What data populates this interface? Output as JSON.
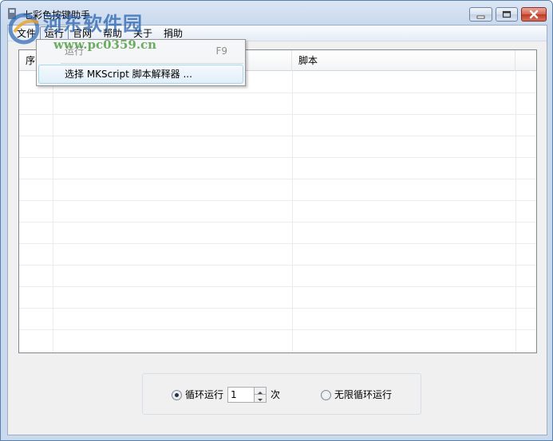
{
  "window": {
    "title": "七彩色按键助手"
  },
  "menubar": {
    "items": [
      "文件",
      "运行",
      "官网",
      "帮助",
      "关于",
      "捐助"
    ]
  },
  "dropdown": {
    "items": [
      {
        "label": "运行",
        "shortcut": "F9",
        "disabled": true
      },
      {
        "label": "选择 MKScript 脚本解释器 ..."
      }
    ]
  },
  "listview": {
    "columns": [
      "序号",
      "",
      "脚本"
    ]
  },
  "options": {
    "loop_label": "循环运行",
    "loop_count": "1",
    "loop_unit": "次",
    "infinite_label": "无限循环运行",
    "selected": "loop"
  },
  "watermark": {
    "site_name": "河东软件园",
    "url": "www.pc0359.cn"
  }
}
